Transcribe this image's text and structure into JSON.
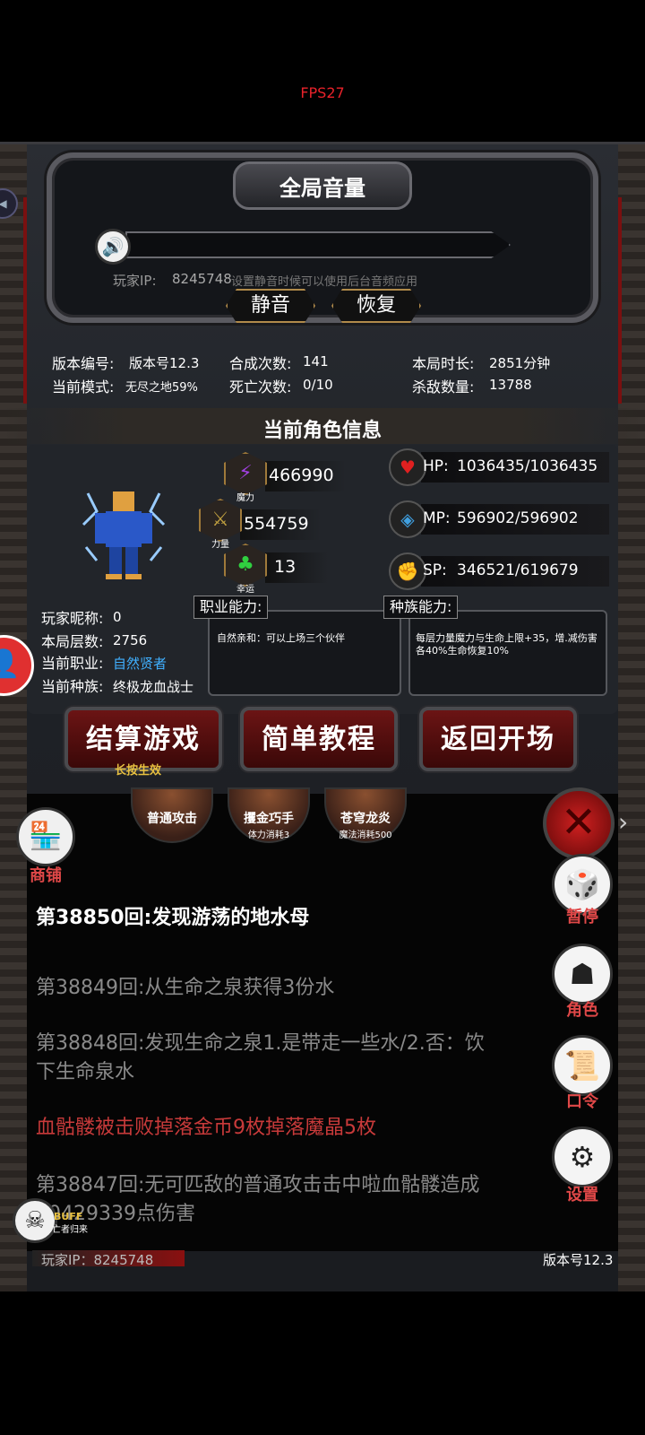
{
  "fps": "FPS27",
  "volume": {
    "title": "全局音量",
    "player_ip_label": "玩家IP:",
    "player_ip_value": "8245748",
    "hint": "设置静音时候可以使用后台音频应用",
    "mute_label": "静音",
    "restore_label": "恢复"
  },
  "stats": {
    "version_label": "版本编号:",
    "version_value": "版本号12.3",
    "craft_label": "合成次数:",
    "craft_value": "141",
    "duration_label": "本局时长:",
    "duration_value": "2851分钟",
    "mode_label": "当前模式:",
    "mode_value": "无尽之地59%",
    "death_label": "死亡次数:",
    "death_value": "0/10",
    "kills_label": "杀敌数量:",
    "kills_value": "13788"
  },
  "character": {
    "header": "当前角色信息",
    "magic": {
      "caption": "魔力",
      "value": "466990",
      "color": "#a040e0"
    },
    "strength": {
      "caption": "力量",
      "value": "554759",
      "color": "#c0a040"
    },
    "luck": {
      "caption": "幸运",
      "value": "13",
      "color": "#30d040"
    },
    "hp": {
      "label": "HP:",
      "value": "1036435/1036435",
      "icon": "heart-icon"
    },
    "mp": {
      "label": "MP:",
      "value": "596902/596902",
      "icon": "magic-icon"
    },
    "sp": {
      "label": "SP:",
      "value": "346521/619679",
      "icon": "muscle-icon"
    },
    "nickname_label": "玩家昵称:",
    "nickname_value": "0",
    "floor_label": "本局层数:",
    "floor_value": "2756",
    "class_label": "当前职业:",
    "class_value": "自然贤者",
    "race_label": "当前种族:",
    "race_value": "终极龙血战士",
    "job_ability_tag": "职业能力:",
    "job_ability_text": "自然亲和：可以上场三个伙伴",
    "race_ability_tag": "种族能力:",
    "race_ability_text": "每层力量魔力与生命上限+35，增.减伤害各40%生命恢复10%"
  },
  "actions": {
    "settle_label": "结算游戏",
    "settle_hint": "长按生效",
    "tutorial_label": "简单教程",
    "return_label": "返回开场"
  },
  "skills": [
    {
      "name": "普通攻击",
      "sub": ""
    },
    {
      "name": "攫金巧手",
      "sub": "体力消耗3"
    },
    {
      "name": "苍穹龙炎",
      "sub": "魔法消耗500"
    }
  ],
  "shop_label": "商铺",
  "side_menu": {
    "pause": "暂停",
    "role": "角色",
    "code": "口令",
    "settings": "设置"
  },
  "log": [
    {
      "text": "第38850回:发现游荡的地水母",
      "style": "main"
    },
    {
      "text": "第38849回:从生命之泉获得3份水",
      "style": "gray"
    },
    {
      "text": "第38848回:发现生命之泉1.是带走一些水/2.否：饮",
      "style": "gray"
    },
    {
      "text": "下生命泉水",
      "style": "gray"
    },
    {
      "text": "血骷髅被击败掉落金币9枚掉落魔晶5枚",
      "style": "red"
    },
    {
      "text": "第38847回:无可匹敌的普通攻击击中啦血骷髅造成",
      "style": "gray"
    },
    {
      "text": "60429339点伤害",
      "style": "gray"
    }
  ],
  "buff": {
    "label": "BUFF",
    "sub": "亡者归来"
  },
  "footer": {
    "ip": "玩家IP：8245748",
    "version": "版本号12.3"
  }
}
